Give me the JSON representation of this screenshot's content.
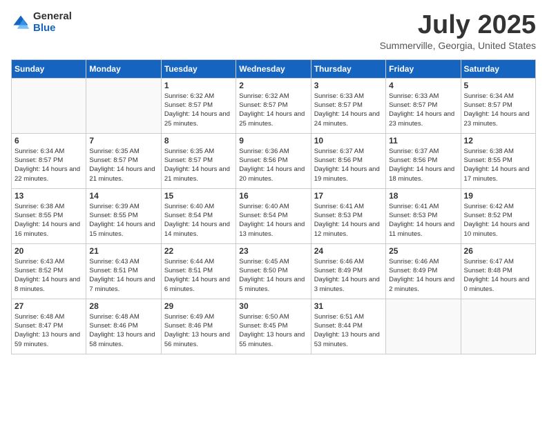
{
  "logo": {
    "general": "General",
    "blue": "Blue"
  },
  "title": "July 2025",
  "location": "Summerville, Georgia, United States",
  "days_of_week": [
    "Sunday",
    "Monday",
    "Tuesday",
    "Wednesday",
    "Thursday",
    "Friday",
    "Saturday"
  ],
  "weeks": [
    [
      {
        "day": "",
        "sunrise": "",
        "sunset": "",
        "daylight": ""
      },
      {
        "day": "",
        "sunrise": "",
        "sunset": "",
        "daylight": ""
      },
      {
        "day": "1",
        "sunrise": "Sunrise: 6:32 AM",
        "sunset": "Sunset: 8:57 PM",
        "daylight": "Daylight: 14 hours and 25 minutes."
      },
      {
        "day": "2",
        "sunrise": "Sunrise: 6:32 AM",
        "sunset": "Sunset: 8:57 PM",
        "daylight": "Daylight: 14 hours and 25 minutes."
      },
      {
        "day": "3",
        "sunrise": "Sunrise: 6:33 AM",
        "sunset": "Sunset: 8:57 PM",
        "daylight": "Daylight: 14 hours and 24 minutes."
      },
      {
        "day": "4",
        "sunrise": "Sunrise: 6:33 AM",
        "sunset": "Sunset: 8:57 PM",
        "daylight": "Daylight: 14 hours and 23 minutes."
      },
      {
        "day": "5",
        "sunrise": "Sunrise: 6:34 AM",
        "sunset": "Sunset: 8:57 PM",
        "daylight": "Daylight: 14 hours and 23 minutes."
      }
    ],
    [
      {
        "day": "6",
        "sunrise": "Sunrise: 6:34 AM",
        "sunset": "Sunset: 8:57 PM",
        "daylight": "Daylight: 14 hours and 22 minutes."
      },
      {
        "day": "7",
        "sunrise": "Sunrise: 6:35 AM",
        "sunset": "Sunset: 8:57 PM",
        "daylight": "Daylight: 14 hours and 21 minutes."
      },
      {
        "day": "8",
        "sunrise": "Sunrise: 6:35 AM",
        "sunset": "Sunset: 8:57 PM",
        "daylight": "Daylight: 14 hours and 21 minutes."
      },
      {
        "day": "9",
        "sunrise": "Sunrise: 6:36 AM",
        "sunset": "Sunset: 8:56 PM",
        "daylight": "Daylight: 14 hours and 20 minutes."
      },
      {
        "day": "10",
        "sunrise": "Sunrise: 6:37 AM",
        "sunset": "Sunset: 8:56 PM",
        "daylight": "Daylight: 14 hours and 19 minutes."
      },
      {
        "day": "11",
        "sunrise": "Sunrise: 6:37 AM",
        "sunset": "Sunset: 8:56 PM",
        "daylight": "Daylight: 14 hours and 18 minutes."
      },
      {
        "day": "12",
        "sunrise": "Sunrise: 6:38 AM",
        "sunset": "Sunset: 8:55 PM",
        "daylight": "Daylight: 14 hours and 17 minutes."
      }
    ],
    [
      {
        "day": "13",
        "sunrise": "Sunrise: 6:38 AM",
        "sunset": "Sunset: 8:55 PM",
        "daylight": "Daylight: 14 hours and 16 minutes."
      },
      {
        "day": "14",
        "sunrise": "Sunrise: 6:39 AM",
        "sunset": "Sunset: 8:55 PM",
        "daylight": "Daylight: 14 hours and 15 minutes."
      },
      {
        "day": "15",
        "sunrise": "Sunrise: 6:40 AM",
        "sunset": "Sunset: 8:54 PM",
        "daylight": "Daylight: 14 hours and 14 minutes."
      },
      {
        "day": "16",
        "sunrise": "Sunrise: 6:40 AM",
        "sunset": "Sunset: 8:54 PM",
        "daylight": "Daylight: 14 hours and 13 minutes."
      },
      {
        "day": "17",
        "sunrise": "Sunrise: 6:41 AM",
        "sunset": "Sunset: 8:53 PM",
        "daylight": "Daylight: 14 hours and 12 minutes."
      },
      {
        "day": "18",
        "sunrise": "Sunrise: 6:41 AM",
        "sunset": "Sunset: 8:53 PM",
        "daylight": "Daylight: 14 hours and 11 minutes."
      },
      {
        "day": "19",
        "sunrise": "Sunrise: 6:42 AM",
        "sunset": "Sunset: 8:52 PM",
        "daylight": "Daylight: 14 hours and 10 minutes."
      }
    ],
    [
      {
        "day": "20",
        "sunrise": "Sunrise: 6:43 AM",
        "sunset": "Sunset: 8:52 PM",
        "daylight": "Daylight: 14 hours and 8 minutes."
      },
      {
        "day": "21",
        "sunrise": "Sunrise: 6:43 AM",
        "sunset": "Sunset: 8:51 PM",
        "daylight": "Daylight: 14 hours and 7 minutes."
      },
      {
        "day": "22",
        "sunrise": "Sunrise: 6:44 AM",
        "sunset": "Sunset: 8:51 PM",
        "daylight": "Daylight: 14 hours and 6 minutes."
      },
      {
        "day": "23",
        "sunrise": "Sunrise: 6:45 AM",
        "sunset": "Sunset: 8:50 PM",
        "daylight": "Daylight: 14 hours and 5 minutes."
      },
      {
        "day": "24",
        "sunrise": "Sunrise: 6:46 AM",
        "sunset": "Sunset: 8:49 PM",
        "daylight": "Daylight: 14 hours and 3 minutes."
      },
      {
        "day": "25",
        "sunrise": "Sunrise: 6:46 AM",
        "sunset": "Sunset: 8:49 PM",
        "daylight": "Daylight: 14 hours and 2 minutes."
      },
      {
        "day": "26",
        "sunrise": "Sunrise: 6:47 AM",
        "sunset": "Sunset: 8:48 PM",
        "daylight": "Daylight: 14 hours and 0 minutes."
      }
    ],
    [
      {
        "day": "27",
        "sunrise": "Sunrise: 6:48 AM",
        "sunset": "Sunset: 8:47 PM",
        "daylight": "Daylight: 13 hours and 59 minutes."
      },
      {
        "day": "28",
        "sunrise": "Sunrise: 6:48 AM",
        "sunset": "Sunset: 8:46 PM",
        "daylight": "Daylight: 13 hours and 58 minutes."
      },
      {
        "day": "29",
        "sunrise": "Sunrise: 6:49 AM",
        "sunset": "Sunset: 8:46 PM",
        "daylight": "Daylight: 13 hours and 56 minutes."
      },
      {
        "day": "30",
        "sunrise": "Sunrise: 6:50 AM",
        "sunset": "Sunset: 8:45 PM",
        "daylight": "Daylight: 13 hours and 55 minutes."
      },
      {
        "day": "31",
        "sunrise": "Sunrise: 6:51 AM",
        "sunset": "Sunset: 8:44 PM",
        "daylight": "Daylight: 13 hours and 53 minutes."
      },
      {
        "day": "",
        "sunrise": "",
        "sunset": "",
        "daylight": ""
      },
      {
        "day": "",
        "sunrise": "",
        "sunset": "",
        "daylight": ""
      }
    ]
  ]
}
